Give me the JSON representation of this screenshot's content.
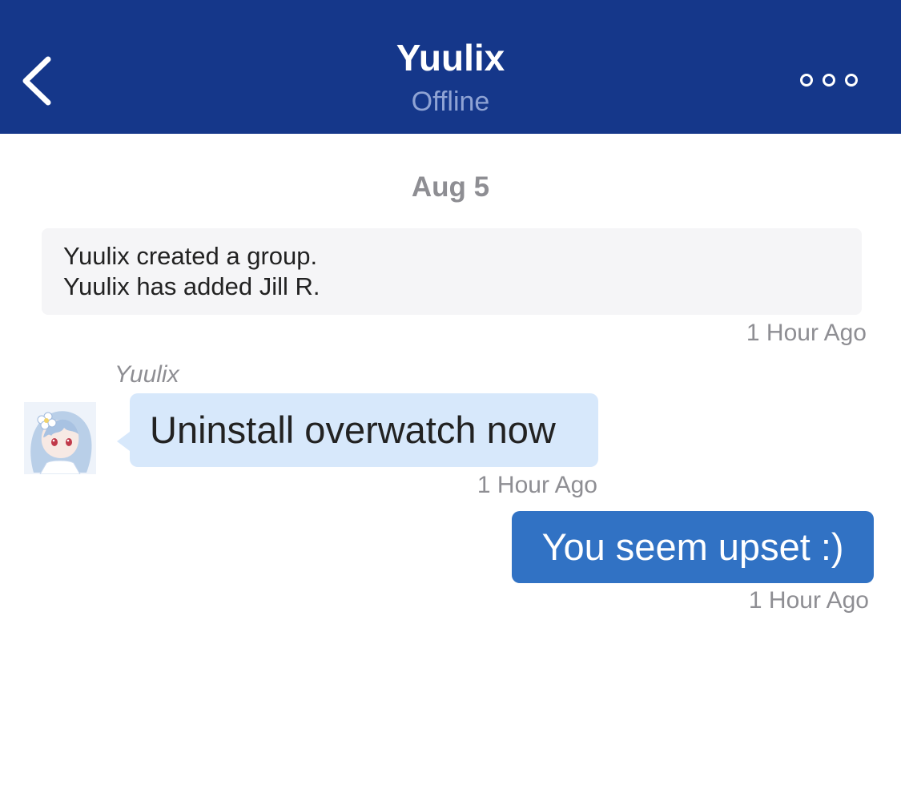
{
  "header": {
    "title": "Yuulix",
    "status": "Offline",
    "back_icon": "chevron-left-icon",
    "more_icon": "more-options-icon",
    "background_color": "#15378a"
  },
  "conversation": {
    "date_divider": "Aug 5",
    "system_notice": {
      "lines": [
        "Yuulix created a group.",
        "Yuulix has added Jill R."
      ],
      "timestamp": "1 Hour Ago"
    },
    "messages": [
      {
        "direction": "incoming",
        "sender": "Yuulix",
        "text": "Uninstall overwatch now",
        "timestamp": "1 Hour Ago",
        "bubble_color": "#d7e8fb"
      },
      {
        "direction": "outgoing",
        "text": "You seem upset :)",
        "timestamp": "1 Hour Ago",
        "bubble_color": "#3172c4"
      }
    ]
  }
}
